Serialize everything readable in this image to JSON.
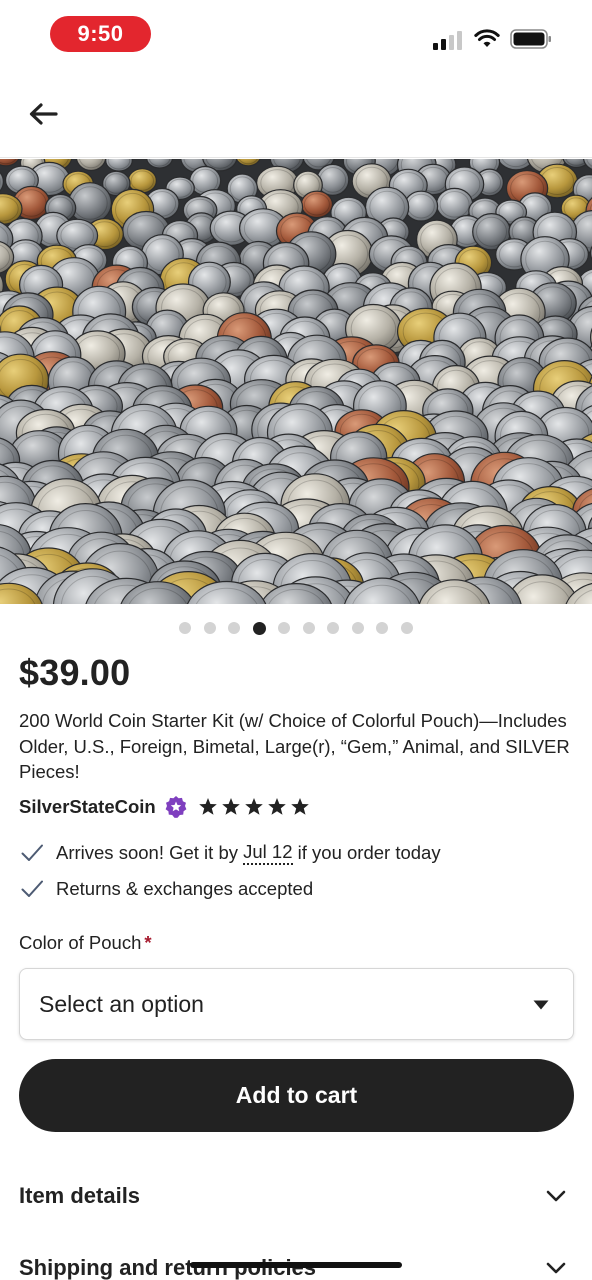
{
  "status_bar": {
    "time": "9:50",
    "signal_icon": "cellular-signal-icon",
    "wifi_icon": "wifi-icon",
    "battery_icon": "battery-icon"
  },
  "nav": {
    "back_icon": "back-arrow-icon"
  },
  "gallery": {
    "image_description_icon": "coin-pile-photo",
    "dot_count": 10,
    "active_index": 3
  },
  "listing": {
    "price": "$39.00",
    "title": "200 World Coin Starter Kit (w/ Choice of Colorful Pouch)—Includes Older, U.S., Foreign, Bimetal, Large(r), “Gem,” Animal, and SILVER Pieces!",
    "shop_name": "SilverStateCoin",
    "rating": 5,
    "rating_max": 5
  },
  "benefits": {
    "delivery_prefix": "Arrives soon! Get it by ",
    "delivery_date": "Jul 12",
    "delivery_suffix": " if you order today",
    "returns": "Returns & exchanges accepted"
  },
  "variation": {
    "label": "Color of Pouch",
    "required_mark": "*",
    "placeholder": "Select an option"
  },
  "actions": {
    "add_to_cart": "Add to cart"
  },
  "sections": {
    "item_details": "Item details",
    "shipping": "Shipping and return policies"
  },
  "colors": {
    "time_pill": "#e3262e",
    "primary_button": "#222222",
    "required": "#a61a2e",
    "star_seller": "#7f3fbf"
  }
}
